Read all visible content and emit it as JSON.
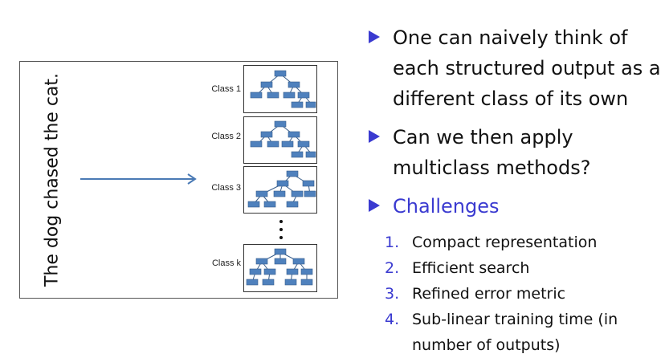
{
  "figure": {
    "sentence": "The dog chased the cat.",
    "classes": [
      {
        "label": "Class 1"
      },
      {
        "label": "Class 2"
      },
      {
        "label": "Class 3"
      },
      {
        "label": "Class k"
      }
    ]
  },
  "bullets": [
    {
      "text": "One can naively think of each structured output as a different class of its own",
      "color": "#111111"
    },
    {
      "text": "Can we then apply multiclass methods?",
      "color": "#111111"
    },
    {
      "text": "Challenges",
      "color": "#3a3ad0",
      "items": [
        {
          "num": "1.",
          "text": "Compact representation"
        },
        {
          "num": "2.",
          "text": "Efficient search"
        },
        {
          "num": "3.",
          "text": "Refined error metric"
        },
        {
          "num": "4.",
          "text": "Sub-linear training time (in number of outputs)"
        }
      ]
    }
  ],
  "colors": {
    "accent": "#3a3ad0",
    "tree_node": "#4f81bd",
    "tree_node_border": "#385d8a",
    "bullet_triangle": "#3a3ad0"
  }
}
